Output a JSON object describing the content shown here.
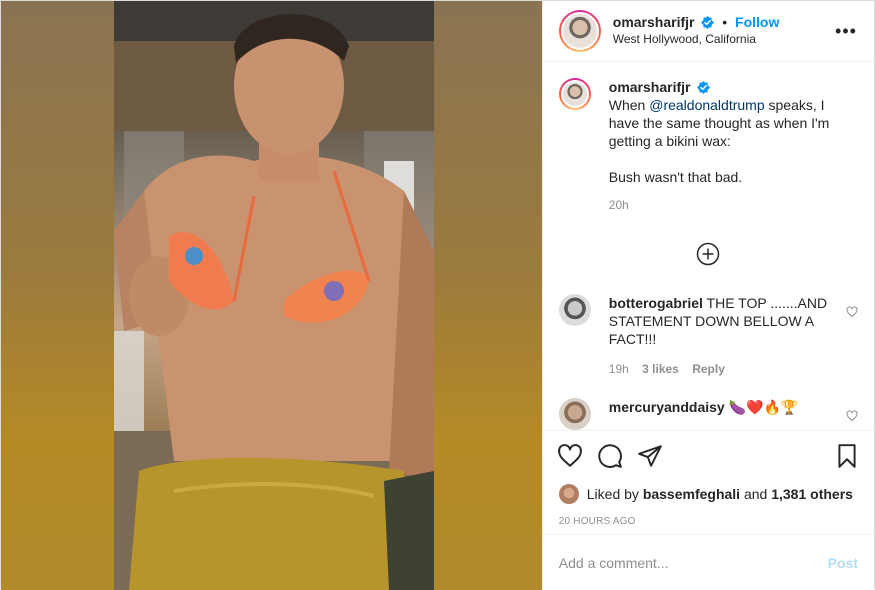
{
  "post": {
    "username": "omarsharifjr",
    "verified": true,
    "follow_label": "Follow",
    "separator": "•",
    "location": "West Hollywood, California",
    "more_icon": "more-horizontal-icon"
  },
  "caption": {
    "username": "omarsharifjr",
    "mention": "@realdonaldtrump",
    "text_before": "When ",
    "text_after": " speaks, I have the same thought as when I'm getting a bikini wax:",
    "text_line2": "Bush wasn't that bad.",
    "time": "20h"
  },
  "load_more_icon": "plus-circle-icon",
  "comments": [
    {
      "username": "botterogabriel",
      "text": "THE TOP .......AND STATEMENT DOWN BELLOW A FACT!!!",
      "time": "19h",
      "likes": "3 likes",
      "reply_label": "Reply"
    },
    {
      "username": "mercuryanddaisy",
      "text": "🍆❤️🔥🏆"
    }
  ],
  "actions": {
    "like_icon": "heart-icon",
    "comment_icon": "comment-icon",
    "share_icon": "share-icon",
    "save_icon": "bookmark-icon"
  },
  "likes": {
    "prefix": "Liked by ",
    "user": "bassemfeghali",
    "middle": " and ",
    "others": "1,381 others"
  },
  "timestamp": "20 HOURS AGO",
  "add_comment": {
    "placeholder": "Add a comment...",
    "post_label": "Post"
  },
  "colors": {
    "accent": "#0095f6",
    "post_disabled": "#b2dffc",
    "muted": "#8e8e8e",
    "mention": "#00376b"
  }
}
